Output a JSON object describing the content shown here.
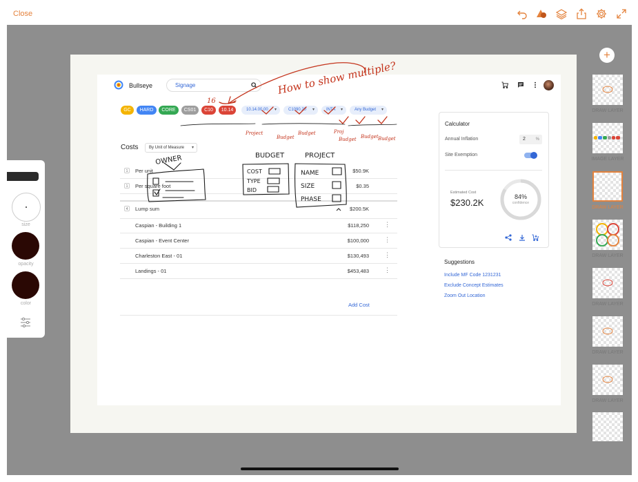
{
  "toolbar": {
    "close_label": "Close",
    "accent_color": "#E4823C",
    "icons": [
      "undo-icon",
      "shapes-icon",
      "layers-icon",
      "share-icon",
      "settings-icon",
      "fullscreen-icon"
    ]
  },
  "palette": {
    "size_label": "size",
    "opacity_label": "opacity",
    "color_label": "color",
    "color_value": "#2A0804"
  },
  "layers": [
    {
      "label": "DRAW LAYER",
      "active": false
    },
    {
      "label": "IMAGE LAYER",
      "active": false
    },
    {
      "label": "DRAW LAYER",
      "active": true
    },
    {
      "label": "DRAW LAYER",
      "active": false
    },
    {
      "label": "DRAW LAYER",
      "active": false
    },
    {
      "label": "DRAW LAYER",
      "active": false
    },
    {
      "label": "DRAW LAYER",
      "active": false
    },
    {
      "label": "",
      "active": false
    }
  ],
  "app": {
    "name": "Bullseye",
    "search_value": "Signage",
    "chips": [
      {
        "label": "GC",
        "color": "#F4B400"
      },
      {
        "label": "HARD",
        "color": "#4285F4"
      },
      {
        "label": "CORE",
        "color": "#34A853"
      },
      {
        "label": "CS01",
        "color": "#9E9E9E"
      },
      {
        "label": "C10",
        "color": "#DB4437"
      },
      {
        "label": "10.14",
        "color": "#DB4437"
      }
    ],
    "filters": [
      "10.14.00.00",
      "C1090.20",
      "INTA",
      "Any Budget"
    ],
    "costs": {
      "title": "Costs",
      "group_by": "By Unit of Measure",
      "rows": [
        {
          "num": "1",
          "name": "Per unit",
          "value": "$50.9K"
        },
        {
          "num": "1",
          "name": "Per square foot",
          "value": "$0.35"
        },
        {
          "num": "4",
          "name": "Lump sum",
          "value": "$200.5K"
        }
      ],
      "items": [
        {
          "name": "Caspian - Building 1",
          "value": "$118,250"
        },
        {
          "name": "Caspian - Event Center",
          "value": "$100,000"
        },
        {
          "name": "Charleston East - 01",
          "value": "$130,493"
        },
        {
          "name": "Landings - 01",
          "value": "$453,483"
        }
      ],
      "add_label": "Add Cost"
    },
    "calculator": {
      "title": "Calculator",
      "inflation_label": "Annual Inflation",
      "inflation_value": "2",
      "inflation_unit": "%",
      "exemption_label": "Site Exemption",
      "exemption_on": true,
      "estimated_label": "Estimated Cost",
      "estimated_value": "$230.2K",
      "confidence_value": "84%",
      "confidence_fraction": 0.84,
      "confidence_label": "confidence"
    },
    "suggestions": {
      "title": "Suggestions",
      "items": [
        "Include MF Code 1231231",
        "Exclude Concept Estimates",
        "Zoom Out Location"
      ]
    }
  },
  "annotations": {
    "red": [
      "How to show multiple?",
      "16",
      "Project",
      "Budget",
      "Budget",
      "Proj",
      "Budget",
      "Budget",
      "Budget"
    ],
    "black": [
      "OWNER",
      "BUDGET",
      "PROJECT",
      "COST",
      "TYPE",
      "BID",
      "NAME",
      "SIZE",
      "PHASE"
    ]
  }
}
